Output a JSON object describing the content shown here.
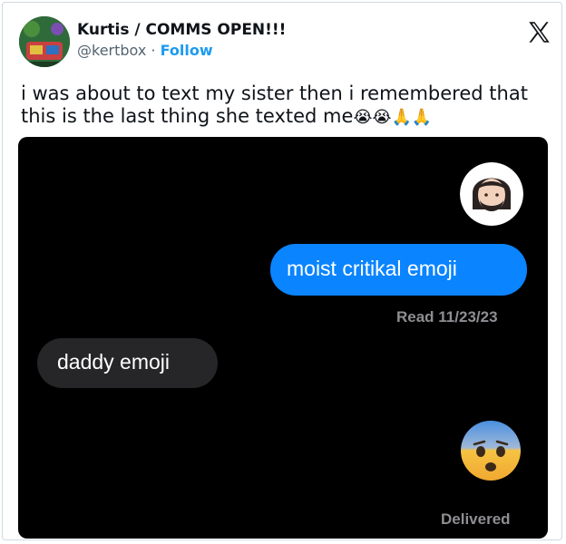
{
  "tweet": {
    "display_name": "Kurtis / COMMS OPEN!!!",
    "handle": "@kertbox",
    "separator": "·",
    "follow_label": "Follow",
    "text": "i was about to text my sister then i remembered that this is the last thing she texted me",
    "trailing_emojis": "😭😭🙏🙏",
    "logo_icon": "x-logo-icon"
  },
  "screenshot": {
    "top_emoji_icon": "person-beard-emoji",
    "sent_message": "moist critikal emoji",
    "read_receipt": "Read 11/23/23",
    "received_message": "daddy emoji",
    "bottom_emoji_icon": "anxious-face-emoji",
    "delivered_status": "Delivered"
  },
  "colors": {
    "follow_blue": "#1d9bf0",
    "imessage_blue": "#0a84ff",
    "received_gray": "#262629",
    "background_black": "#000000"
  }
}
